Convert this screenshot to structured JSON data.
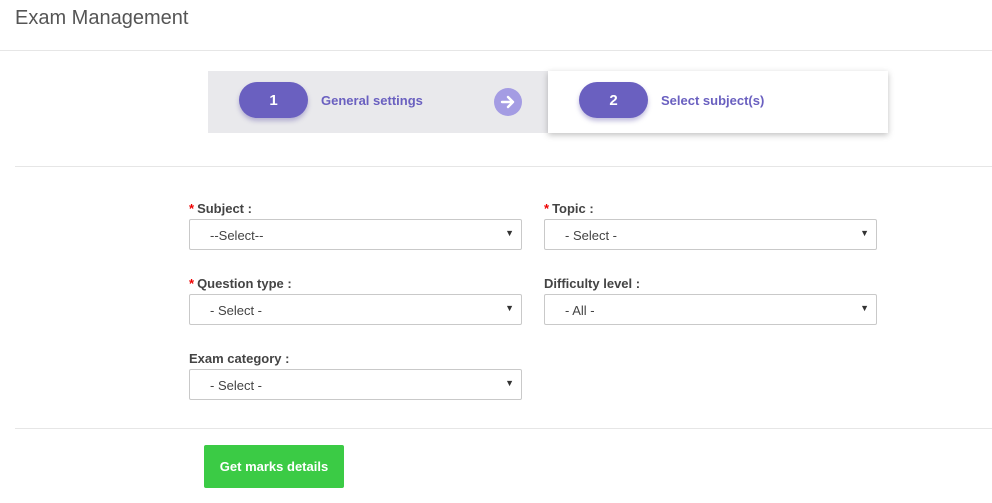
{
  "header": {
    "title": "Exam Management"
  },
  "stepper": {
    "steps": [
      {
        "number": "1",
        "label": "General settings",
        "active": false
      },
      {
        "number": "2",
        "label": "Select subject(s)",
        "active": true
      }
    ],
    "accent_color": "#6a60c0"
  },
  "form": {
    "subject": {
      "label": "Subject :",
      "required": true,
      "value": "--Select--"
    },
    "topic": {
      "label": "Topic :",
      "required": true,
      "value": "- Select -"
    },
    "question_type": {
      "label": "Question type :",
      "required": true,
      "value": "- Select -"
    },
    "difficulty": {
      "label": "Difficulty level :",
      "required": false,
      "value": "- All -"
    },
    "exam_category": {
      "label": "Exam category :",
      "required": false,
      "value": "- Select -"
    },
    "required_marker": "*"
  },
  "actions": {
    "submit_label": "Get marks details",
    "submit_color": "#3bcb45"
  }
}
